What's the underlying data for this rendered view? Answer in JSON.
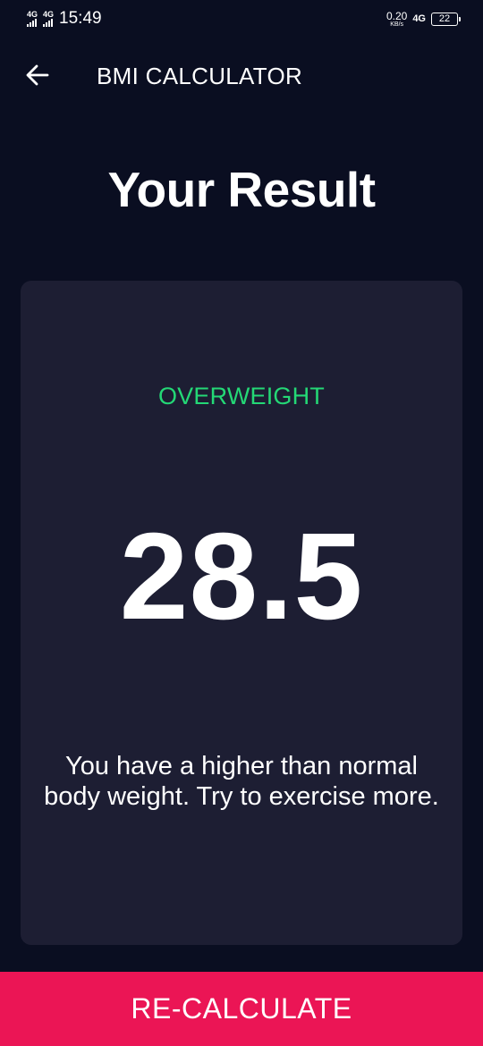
{
  "status_bar": {
    "sim1": "4G",
    "sim2": "4G",
    "time": "15:49",
    "speed_value": "0.20",
    "speed_unit": "KB/s",
    "data_type": "4G",
    "battery": "22"
  },
  "app_bar": {
    "back_icon": "arrow-left-icon",
    "title": "BMI CALCULATOR"
  },
  "page": {
    "title": "Your Result"
  },
  "result": {
    "status": "OVERWEIGHT",
    "status_color": "#24d876",
    "bmi": "28.5",
    "advice": "You have a higher than normal body weight. Try to exercise more."
  },
  "actions": {
    "recalculate_label": "RE-CALCULATE",
    "accent_color": "#eb1555"
  },
  "colors": {
    "background": "#0a0e21",
    "card": "#1d1e33"
  }
}
